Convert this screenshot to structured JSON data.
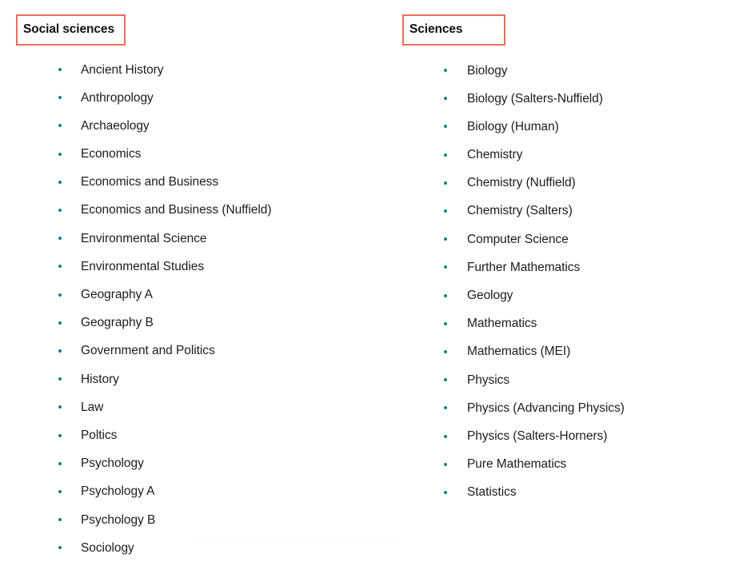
{
  "page": {
    "background_color": "#ffffff",
    "text_color": "#1c1c1c",
    "heading_border_color": "#e8705a",
    "bullet_color": "#14808c"
  },
  "columns": [
    {
      "heading": "Social sciences",
      "items": [
        "Ancient History",
        "Anthropology",
        "Archaeology",
        "Economics",
        "Economics and Business",
        "Economics and Business (Nuffield)",
        "Environmental Science",
        "Environmental Studies",
        "Geography A",
        "Geography B",
        "Government and Politics",
        "History",
        "Law",
        "Poltics",
        "Psychology",
        "Psychology A",
        "Psychology B",
        "Sociology"
      ]
    },
    {
      "heading": "Sciences",
      "items": [
        "Biology",
        "Biology (Salters-Nuffield)",
        "Biology (Human)",
        "Chemistry",
        "Chemistry (Nuffield)",
        "Chemistry (Salters)",
        "Computer Science",
        "Further Mathematics",
        "Geology",
        "Mathematics",
        "Mathematics (MEI)",
        "Physics",
        "Physics (Advancing Physics)",
        "Physics (Salters-Horners)",
        "Pure Mathematics",
        "Statistics"
      ]
    }
  ]
}
